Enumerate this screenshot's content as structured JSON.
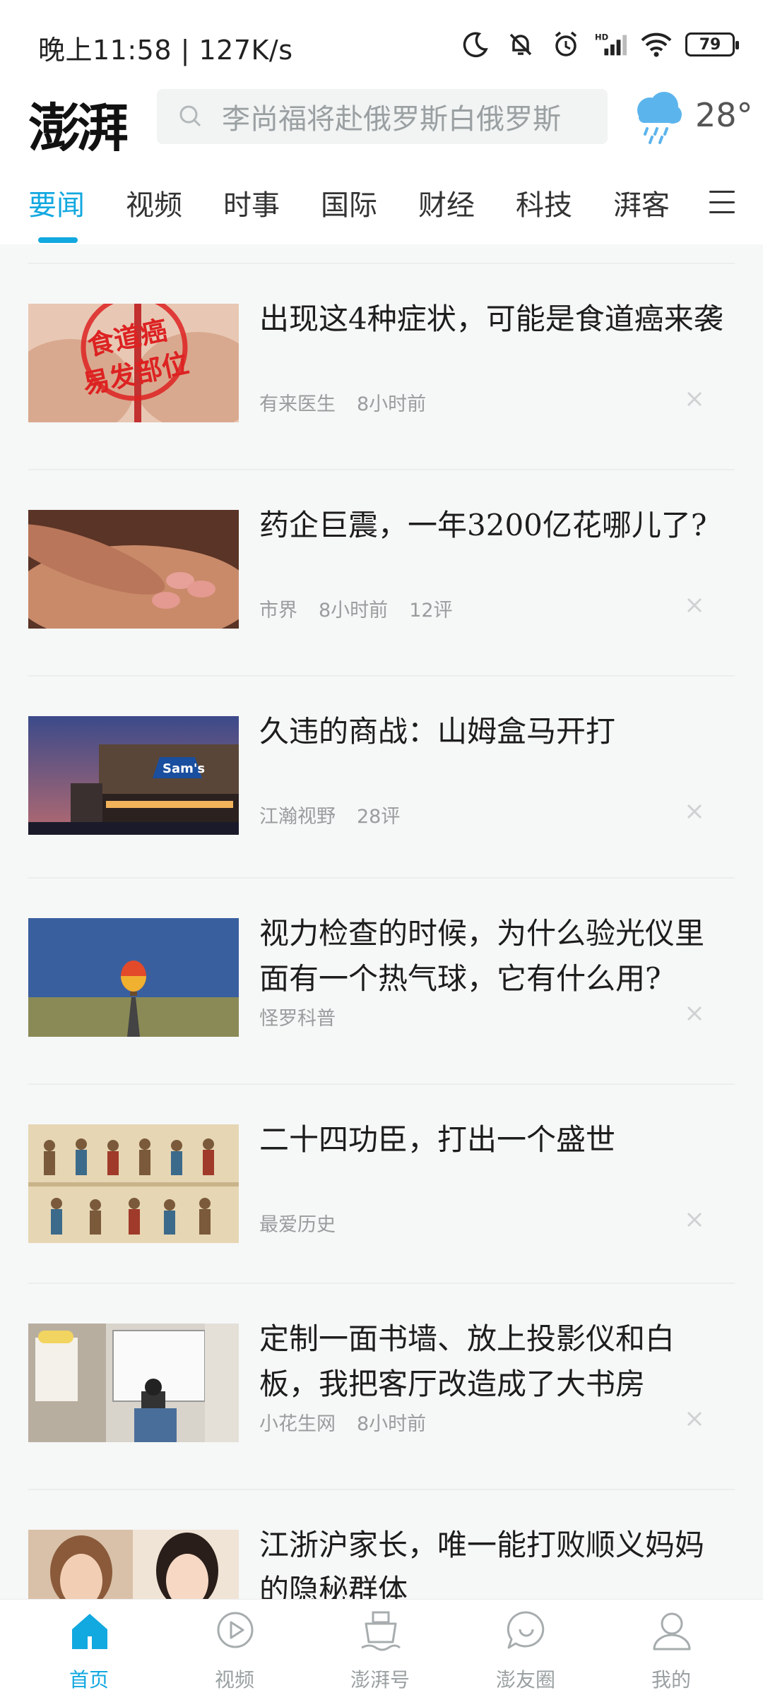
{
  "status_bar": {
    "time": "晚上11:58 | 127K/s",
    "battery": "79"
  },
  "header": {
    "logo": "澎湃",
    "search_placeholder": "李尚福将赴俄罗斯白俄罗斯",
    "temperature": "28°"
  },
  "tabs": [
    {
      "label": "要闻"
    },
    {
      "label": "视频"
    },
    {
      "label": "时事"
    },
    {
      "label": "国际"
    },
    {
      "label": "财经"
    },
    {
      "label": "科技"
    },
    {
      "label": "湃客"
    }
  ],
  "articles": [
    {
      "title": "出现这4种症状，可能是食道癌来袭",
      "source": "有来医生",
      "time": "8小时前",
      "comments": "",
      "thumb_text": [
        "食道癌",
        "易发部位"
      ]
    },
    {
      "title": "药企巨震，一年3200亿花哪儿了?",
      "source": "市界",
      "time": "8小时前",
      "comments": "12评"
    },
    {
      "title": "久违的商战：山姆盒马开打",
      "source": "江瀚视野",
      "time": "",
      "comments": "28评",
      "thumb_text": [
        "Sam's"
      ]
    },
    {
      "title": "视力检查的时候，为什么验光仪里面有一个热气球，它有什么用?",
      "source": "怪罗科普",
      "time": "",
      "comments": ""
    },
    {
      "title": "二十四功臣，打出一个盛世",
      "source": "最爱历史",
      "time": "",
      "comments": ""
    },
    {
      "title": "定制一面书墙、放上投影仪和白板，我把客厅改造成了大书房",
      "source": "小花生网",
      "time": "8小时前",
      "comments": ""
    },
    {
      "title": "江浙沪家长，唯一能打败顺义妈妈的隐秘群体",
      "source": "",
      "time": "",
      "comments": ""
    }
  ],
  "bottom_nav": [
    {
      "label": "首页",
      "icon": "home-icon"
    },
    {
      "label": "视频",
      "icon": "video-play-icon"
    },
    {
      "label": "澎湃号",
      "icon": "ship-icon"
    },
    {
      "label": "澎友圈",
      "icon": "chat-bubble-icon"
    },
    {
      "label": "我的",
      "icon": "user-icon"
    }
  ],
  "colors": {
    "accent": "#12a8e0",
    "background": "#f6f7f7"
  }
}
